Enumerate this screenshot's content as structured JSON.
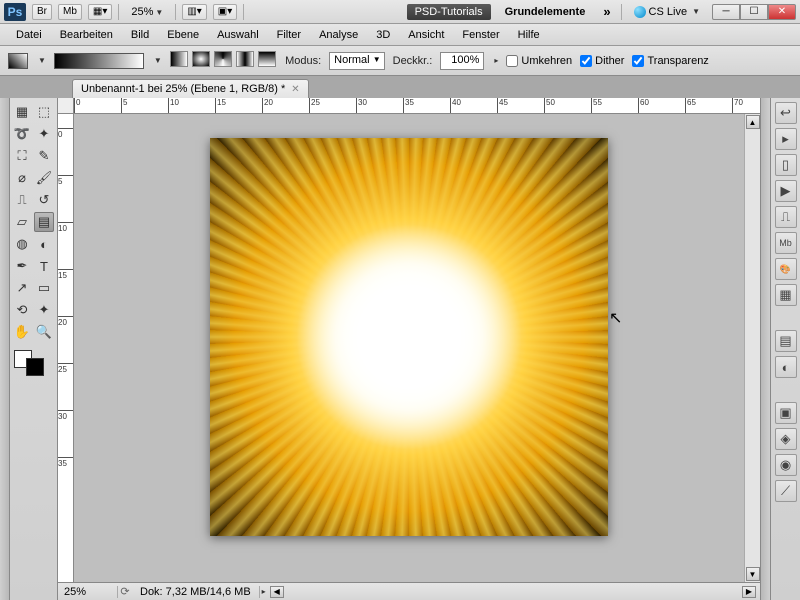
{
  "titlebar": {
    "app": "Ps",
    "br": "Br",
    "mb": "Mb",
    "zoom": "25%",
    "workspace_active": "PSD-Tutorials",
    "workspace_other": "Grundelemente",
    "expand": "»",
    "cslive": "CS Live"
  },
  "menu": {
    "items": [
      "Datei",
      "Bearbeiten",
      "Bild",
      "Ebene",
      "Auswahl",
      "Filter",
      "Analyse",
      "3D",
      "Ansicht",
      "Fenster",
      "Hilfe"
    ]
  },
  "options": {
    "mode_label": "Modus:",
    "mode_value": "Normal",
    "opacity_label": "Deckkr.:",
    "opacity_value": "100%",
    "reverse": "Umkehren",
    "dither": "Dither",
    "transparency": "Transparenz"
  },
  "doctab": {
    "title": "Unbenannt-1 bei 25% (Ebene 1, RGB/8) *"
  },
  "ruler_h": [
    "0",
    "5",
    "10",
    "15",
    "20",
    "25",
    "30",
    "35",
    "40",
    "45",
    "50",
    "55",
    "60",
    "65",
    "70"
  ],
  "ruler_v": [
    "0",
    "5",
    "10",
    "15",
    "20",
    "25",
    "30",
    "35"
  ],
  "status": {
    "zoom": "25%",
    "doc": "Dok: 7,32 MB/14,6 MB"
  },
  "tools": [
    {
      "name": "move-tool",
      "g": "▦"
    },
    {
      "name": "marquee-tool",
      "g": "⬚"
    },
    {
      "name": "lasso-tool",
      "g": "➰"
    },
    {
      "name": "magic-wand-tool",
      "g": "✦"
    },
    {
      "name": "crop-tool",
      "g": "⛶"
    },
    {
      "name": "eyedropper-tool",
      "g": "✎"
    },
    {
      "name": "healing-brush-tool",
      "g": "⌀"
    },
    {
      "name": "brush-tool",
      "g": "🖌"
    },
    {
      "name": "stamp-tool",
      "g": "⎍"
    },
    {
      "name": "history-brush-tool",
      "g": "↺"
    },
    {
      "name": "eraser-tool",
      "g": "▱"
    },
    {
      "name": "gradient-tool",
      "g": "▤",
      "sel": true
    },
    {
      "name": "blur-tool",
      "g": "◍"
    },
    {
      "name": "dodge-tool",
      "g": "◐"
    },
    {
      "name": "pen-tool",
      "g": "✒"
    },
    {
      "name": "type-tool",
      "g": "T"
    },
    {
      "name": "path-select-tool",
      "g": "↗"
    },
    {
      "name": "shape-tool",
      "g": "▭"
    },
    {
      "name": "3d-tool",
      "g": "⟲"
    },
    {
      "name": "3d-camera-tool",
      "g": "✦"
    },
    {
      "name": "hand-tool",
      "g": "✋"
    },
    {
      "name": "zoom-tool",
      "g": "🔍"
    }
  ],
  "right_icons": [
    {
      "name": "history-panel-icon",
      "g": "↩"
    },
    {
      "name": "actions-panel-icon",
      "g": "▸"
    },
    {
      "name": "properties-panel-icon",
      "g": "▯"
    },
    {
      "name": "play-panel-icon",
      "g": "▶"
    },
    {
      "name": "stamp-panel-icon",
      "g": "⎍"
    },
    {
      "name": "mb-panel-icon",
      "g": "Mb"
    },
    {
      "name": "color-panel-icon",
      "g": "🎨"
    },
    {
      "name": "swatches-panel-icon",
      "g": "▦"
    },
    {
      "name": "styles-panel-icon",
      "g": "▤"
    },
    {
      "name": "adjust-panel-icon",
      "g": "◐"
    },
    {
      "name": "masks-panel-icon",
      "g": "▣"
    },
    {
      "name": "layers-panel-icon",
      "g": "◈"
    },
    {
      "name": "channels-panel-icon",
      "g": "◉"
    },
    {
      "name": "paths-panel-icon",
      "g": "⟋"
    }
  ]
}
